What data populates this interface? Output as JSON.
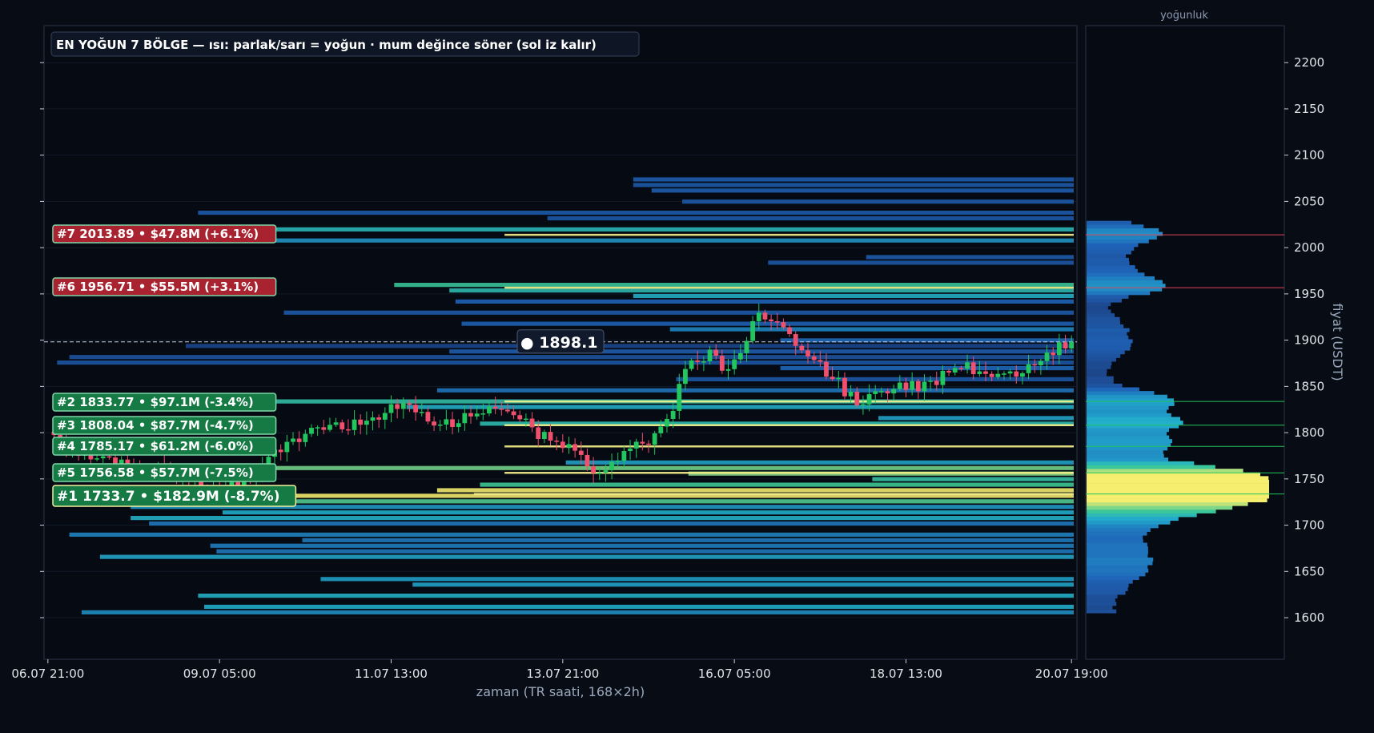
{
  "chart_data": {
    "type": "heatmap",
    "title": "EN YOĞUN 7 BÖLGE — ısı: parlak/sarı = yoğun · mum değince söner (sol iz kalır)",
    "xlabel": "zaman (TR saati, 168×2h)",
    "ylabel": "fiyat (USDT)",
    "side_panel_title": "yoğunluk",
    "ylim": [
      1555,
      2240
    ],
    "y_ticks": [
      "1600",
      "1650",
      "1700",
      "1750",
      "1800",
      "1850",
      "1900",
      "1950",
      "2000",
      "2050",
      "2100",
      "2150",
      "2200"
    ],
    "x_ticks": [
      "06.07 21:00",
      "09.07 05:00",
      "11.07 13:00",
      "13.07 21:00",
      "16.07 05:00",
      "18.07 13:00",
      "20.07 19:00"
    ],
    "current_price": {
      "value": 1898.1,
      "label": "● 1898.1"
    },
    "zones": [
      {
        "rank": 1,
        "price": 1733.7,
        "label": "#1  1733.7  •  $182.9M  (-8.7%)",
        "side": "support"
      },
      {
        "rank": 2,
        "price": 1833.77,
        "label": "#2  1833.77  •  $97.1M  (-3.4%)",
        "side": "support"
      },
      {
        "rank": 3,
        "price": 1808.04,
        "label": "#3  1808.04  •  $87.7M  (-4.7%)",
        "side": "support"
      },
      {
        "rank": 4,
        "price": 1785.17,
        "label": "#4  1785.17  •  $61.2M  (-6.0%)",
        "side": "support"
      },
      {
        "rank": 5,
        "price": 1756.58,
        "label": "#5  1756.58  •  $57.7M  (-7.5%)",
        "side": "support"
      },
      {
        "rank": 6,
        "price": 1956.71,
        "label": "#6  1956.71  •  $55.5M  (+3.1%)",
        "side": "resistance"
      },
      {
        "rank": 7,
        "price": 2013.89,
        "label": "#7  2013.89  •  $47.8M  (+6.1%)",
        "side": "resistance"
      }
    ],
    "candle_count": 168,
    "price_path": [
      [
        0,
        1800
      ],
      [
        6,
        1775
      ],
      [
        12,
        1768
      ],
      [
        18,
        1760
      ],
      [
        24,
        1745
      ],
      [
        28,
        1740
      ],
      [
        32,
        1745
      ],
      [
        36,
        1770
      ],
      [
        40,
        1795
      ],
      [
        46,
        1805
      ],
      [
        52,
        1810
      ],
      [
        56,
        1830
      ],
      [
        60,
        1822
      ],
      [
        64,
        1806
      ],
      [
        68,
        1815
      ],
      [
        72,
        1830
      ],
      [
        76,
        1818
      ],
      [
        80,
        1800
      ],
      [
        84,
        1785
      ],
      [
        88,
        1768
      ],
      [
        90,
        1758
      ],
      [
        94,
        1780
      ],
      [
        98,
        1790
      ],
      [
        102,
        1830
      ],
      [
        104,
        1870
      ],
      [
        106,
        1878
      ],
      [
        108,
        1885
      ],
      [
        110,
        1870
      ],
      [
        112,
        1880
      ],
      [
        114,
        1905
      ],
      [
        116,
        1925
      ],
      [
        118,
        1925
      ],
      [
        120,
        1915
      ],
      [
        122,
        1890
      ],
      [
        124,
        1885
      ],
      [
        126,
        1870
      ],
      [
        128,
        1862
      ],
      [
        130,
        1845
      ],
      [
        132,
        1832
      ],
      [
        134,
        1836
      ],
      [
        136,
        1848
      ],
      [
        138,
        1848
      ],
      [
        140,
        1848
      ],
      [
        142,
        1850
      ],
      [
        144,
        1852
      ],
      [
        146,
        1862
      ],
      [
        148,
        1868
      ],
      [
        150,
        1870
      ],
      [
        152,
        1865
      ],
      [
        154,
        1865
      ],
      [
        156,
        1870
      ],
      [
        158,
        1862
      ],
      [
        160,
        1870
      ],
      [
        162,
        1878
      ],
      [
        164,
        1888
      ],
      [
        166,
        1895
      ],
      [
        168,
        1898
      ]
    ]
  },
  "colors": {
    "background": "#080c14",
    "up_candle": "#22c55e",
    "down_candle": "#f0506e",
    "support_box": "#157a44",
    "resistance_box": "#a8232f",
    "heat_low": "#1e3a8a",
    "heat_mid": "#22b8d8",
    "heat_high": "#f2ee6a"
  }
}
